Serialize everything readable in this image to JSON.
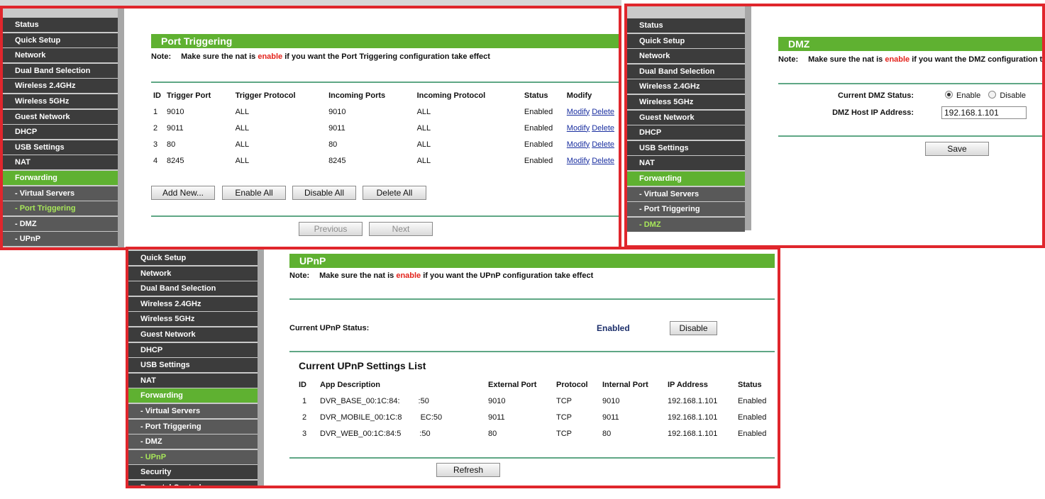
{
  "menu_full": [
    "Status",
    "Quick Setup",
    "Network",
    "Dual Band Selection",
    "Wireless 2.4GHz",
    "Wireless 5GHz",
    "Guest Network",
    "DHCP",
    "USB Settings",
    "NAT",
    "Forwarding",
    "- Virtual Servers",
    "- Port Triggering",
    "- DMZ",
    "- UPnP",
    "Security",
    "Parental Control"
  ],
  "port_triggering": {
    "title": "Port Triggering",
    "note_label": "Note:",
    "note_pre": "Make sure the nat is",
    "note_enable": "enable",
    "note_post": "if you want the Port Triggering configuration take effect",
    "headers": [
      "ID",
      "Trigger Port",
      "Trigger Protocol",
      "Incoming Ports",
      "Incoming Protocol",
      "Status",
      "Modify"
    ],
    "rows": [
      {
        "id": "1",
        "trigger_port": "9010",
        "trigger_protocol": "ALL",
        "incoming_ports": "9010",
        "incoming_protocol": "ALL",
        "status": "Enabled"
      },
      {
        "id": "2",
        "trigger_port": "9011",
        "trigger_protocol": "ALL",
        "incoming_ports": "9011",
        "incoming_protocol": "ALL",
        "status": "Enabled"
      },
      {
        "id": "3",
        "trigger_port": "80",
        "trigger_protocol": "ALL",
        "incoming_ports": "80",
        "incoming_protocol": "ALL",
        "status": "Enabled"
      },
      {
        "id": "4",
        "trigger_port": "8245",
        "trigger_protocol": "ALL",
        "incoming_ports": "8245",
        "incoming_protocol": "ALL",
        "status": "Enabled"
      }
    ],
    "modify_link": "Modify",
    "delete_link": "Delete",
    "buttons": {
      "add_new": "Add New...",
      "enable_all": "Enable All",
      "disable_all": "Disable All",
      "delete_all": "Delete All"
    },
    "pager": {
      "previous": "Previous",
      "next": "Next"
    }
  },
  "dmz": {
    "title": "DMZ",
    "note_label": "Note:",
    "note_pre": "Make sure the nat is",
    "note_enable": "enable",
    "note_post": "if you want the DMZ configuration t",
    "status_label": "Current DMZ Status:",
    "enable_option": "Enable",
    "disable_option": "Disable",
    "selected": "Enable",
    "host_label": "DMZ Host IP Address:",
    "host_value": "192.168.1.101",
    "save": "Save"
  },
  "upnp": {
    "title": "UPnP",
    "note_label": "Note:",
    "note_pre": "Make sure the nat is",
    "note_enable": "enable",
    "note_post": "if you want the UPnP configuration take effect",
    "status_label": "Current UPnP Status:",
    "status_value": "Enabled",
    "disable_button": "Disable",
    "list_title": "Current UPnP Settings List",
    "headers": [
      "ID",
      "App Description",
      "External Port",
      "Protocol",
      "Internal Port",
      "IP Address",
      "Status"
    ],
    "rows": [
      {
        "id": "1",
        "desc_a": "DVR_BASE_00:1C:84:",
        "desc_b": ":50",
        "external_port": "9010",
        "protocol": "TCP",
        "internal_port": "9010",
        "ip": "192.168.1.101",
        "status": "Enabled"
      },
      {
        "id": "2",
        "desc_a": "DVR_MOBILE_00:1C:8",
        "desc_b": "EC:50",
        "external_port": "9011",
        "protocol": "TCP",
        "internal_port": "9011",
        "ip": "192.168.1.101",
        "status": "Enabled"
      },
      {
        "id": "3",
        "desc_a": "DVR_WEB_00:1C:84:5",
        "desc_b": ":50",
        "external_port": "80",
        "protocol": "TCP",
        "internal_port": "80",
        "ip": "192.168.1.101",
        "status": "Enabled"
      }
    ],
    "refresh": "Refresh"
  },
  "colors": {
    "border": "#e0262c",
    "accent": "#5fb131",
    "menu_bg": "#3c3c3c",
    "submenu_bg": "#595959",
    "enable_text": "#e3231c",
    "link": "#1a2fa0"
  }
}
